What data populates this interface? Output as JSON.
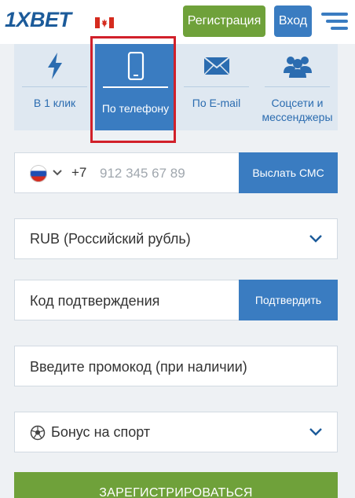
{
  "header": {
    "logo_text": "1XBET",
    "flag_icon": "canada-flag-icon",
    "register_label": "Регистрация",
    "login_label": "Вход",
    "menu_icon": "hamburger-menu-icon"
  },
  "tabs": [
    {
      "label": "В 1 клик",
      "icon": "lightning-icon",
      "active": false
    },
    {
      "label": "По телефону",
      "icon": "phone-icon",
      "active": true
    },
    {
      "label": "По E-mail",
      "icon": "envelope-icon",
      "active": false
    },
    {
      "label": "Соцсети и мессенджеры",
      "icon": "users-icon",
      "active": false
    }
  ],
  "phone": {
    "country_icon": "russia-flag-icon",
    "prefix": "+7",
    "placeholder": "912 345 67 89",
    "send_sms_label": "Выслать СМС"
  },
  "currency": {
    "value": "RUB (Российский рубль)"
  },
  "confirmation": {
    "placeholder": "Код подтверждения",
    "confirm_label": "Подтвердить"
  },
  "promo": {
    "placeholder": "Введите промокод (при наличии)"
  },
  "bonus": {
    "icon": "soccer-ball-icon",
    "value": "Бонус на спорт"
  },
  "submit_label": "ЗАРЕГИСТРИРОВАТЬСЯ",
  "colors": {
    "brand_blue": "#3a7cc1",
    "brand_green": "#6fa13a",
    "highlight_red": "#d1202a",
    "tab_background": "#dfe8f1"
  }
}
